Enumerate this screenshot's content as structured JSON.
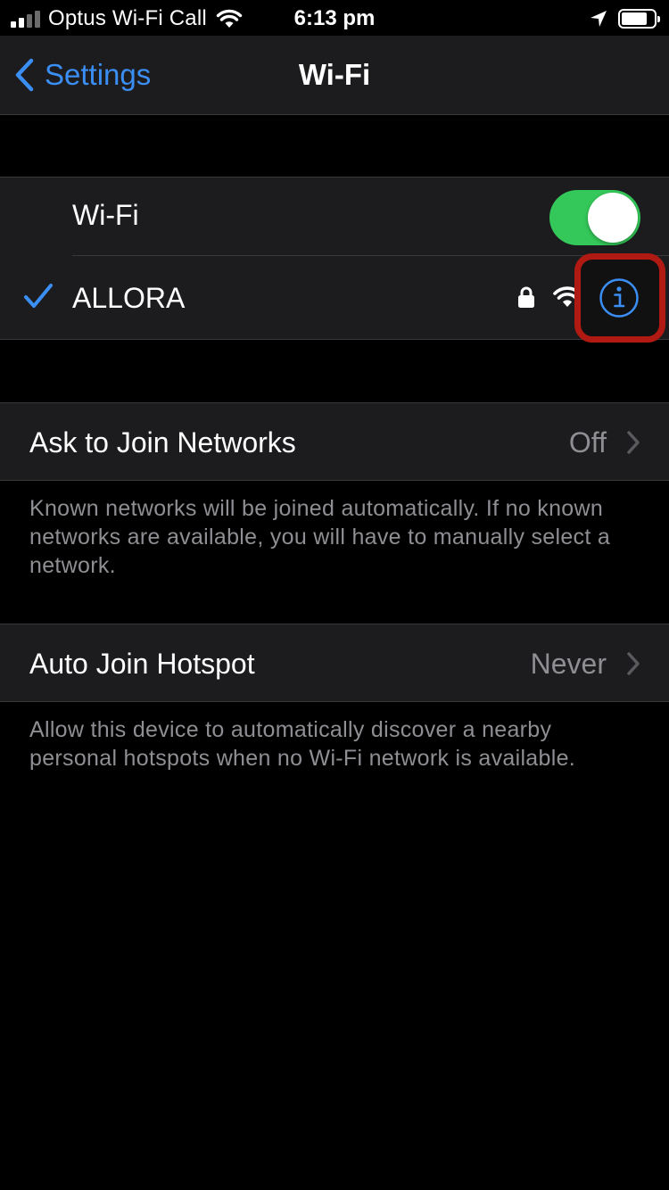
{
  "status_bar": {
    "carrier": "Optus Wi-Fi Call",
    "time": "6:13 pm",
    "signal_bars": 4,
    "signal_bars_active": 2,
    "battery_level": 0.8
  },
  "nav": {
    "back_label": "Settings",
    "title": "Wi-Fi"
  },
  "wifi_section": {
    "toggle_label": "Wi-Fi",
    "toggle_on": true,
    "connected_network": {
      "name": "ALLORA",
      "secured": true,
      "icons": [
        "checkmark-icon",
        "lock-icon",
        "wifi-signal-icon",
        "info-icon"
      ]
    }
  },
  "ask_to_join": {
    "label": "Ask to Join Networks",
    "value": "Off",
    "footnote": "Known networks will be joined automatically. If no known networks are available, you will have to manually select a network."
  },
  "auto_join_hotspot": {
    "label": "Auto Join Hotspot",
    "value": "Never",
    "footnote": "Allow this device to automatically discover a nearby personal hotspots when no Wi-Fi network is available."
  },
  "colors": {
    "accent": "#3b8ef3",
    "toggle_on": "#34c759",
    "highlight": "#b11a12",
    "cell_bg": "#1c1c1e",
    "secondary_text": "#8e8e93"
  }
}
